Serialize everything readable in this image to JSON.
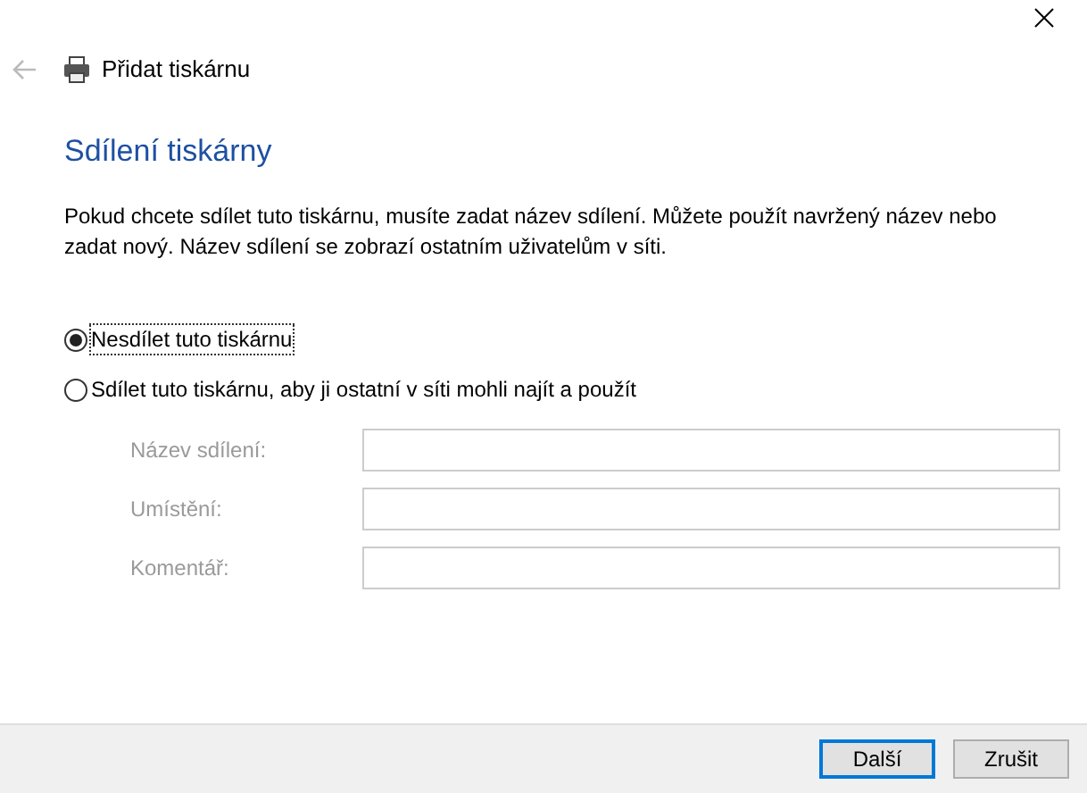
{
  "window": {
    "title": "Přidat tiskárnu"
  },
  "heading": "Sdílení tiskárny",
  "description": "Pokud chcete sdílet tuto tiskárnu, musíte zadat název sdílení. Můžete použít navržený název nebo zadat nový. Název sdílení se zobrazí ostatním uživatelům v síti.",
  "options": [
    {
      "label": "Nesdílet tuto tiskárnu",
      "selected": true
    },
    {
      "label": "Sdílet tuto tiskárnu, aby ji ostatní v síti mohli najít a použít",
      "selected": false
    }
  ],
  "fields": [
    {
      "label": "Název sdílení:",
      "disabled": true
    },
    {
      "label": "Umístění:",
      "disabled": true
    },
    {
      "label": "Komentář:",
      "disabled": true
    }
  ],
  "buttons": [
    {
      "label": "Další",
      "default": true
    },
    {
      "label": "Zrušit",
      "default": false
    }
  ]
}
